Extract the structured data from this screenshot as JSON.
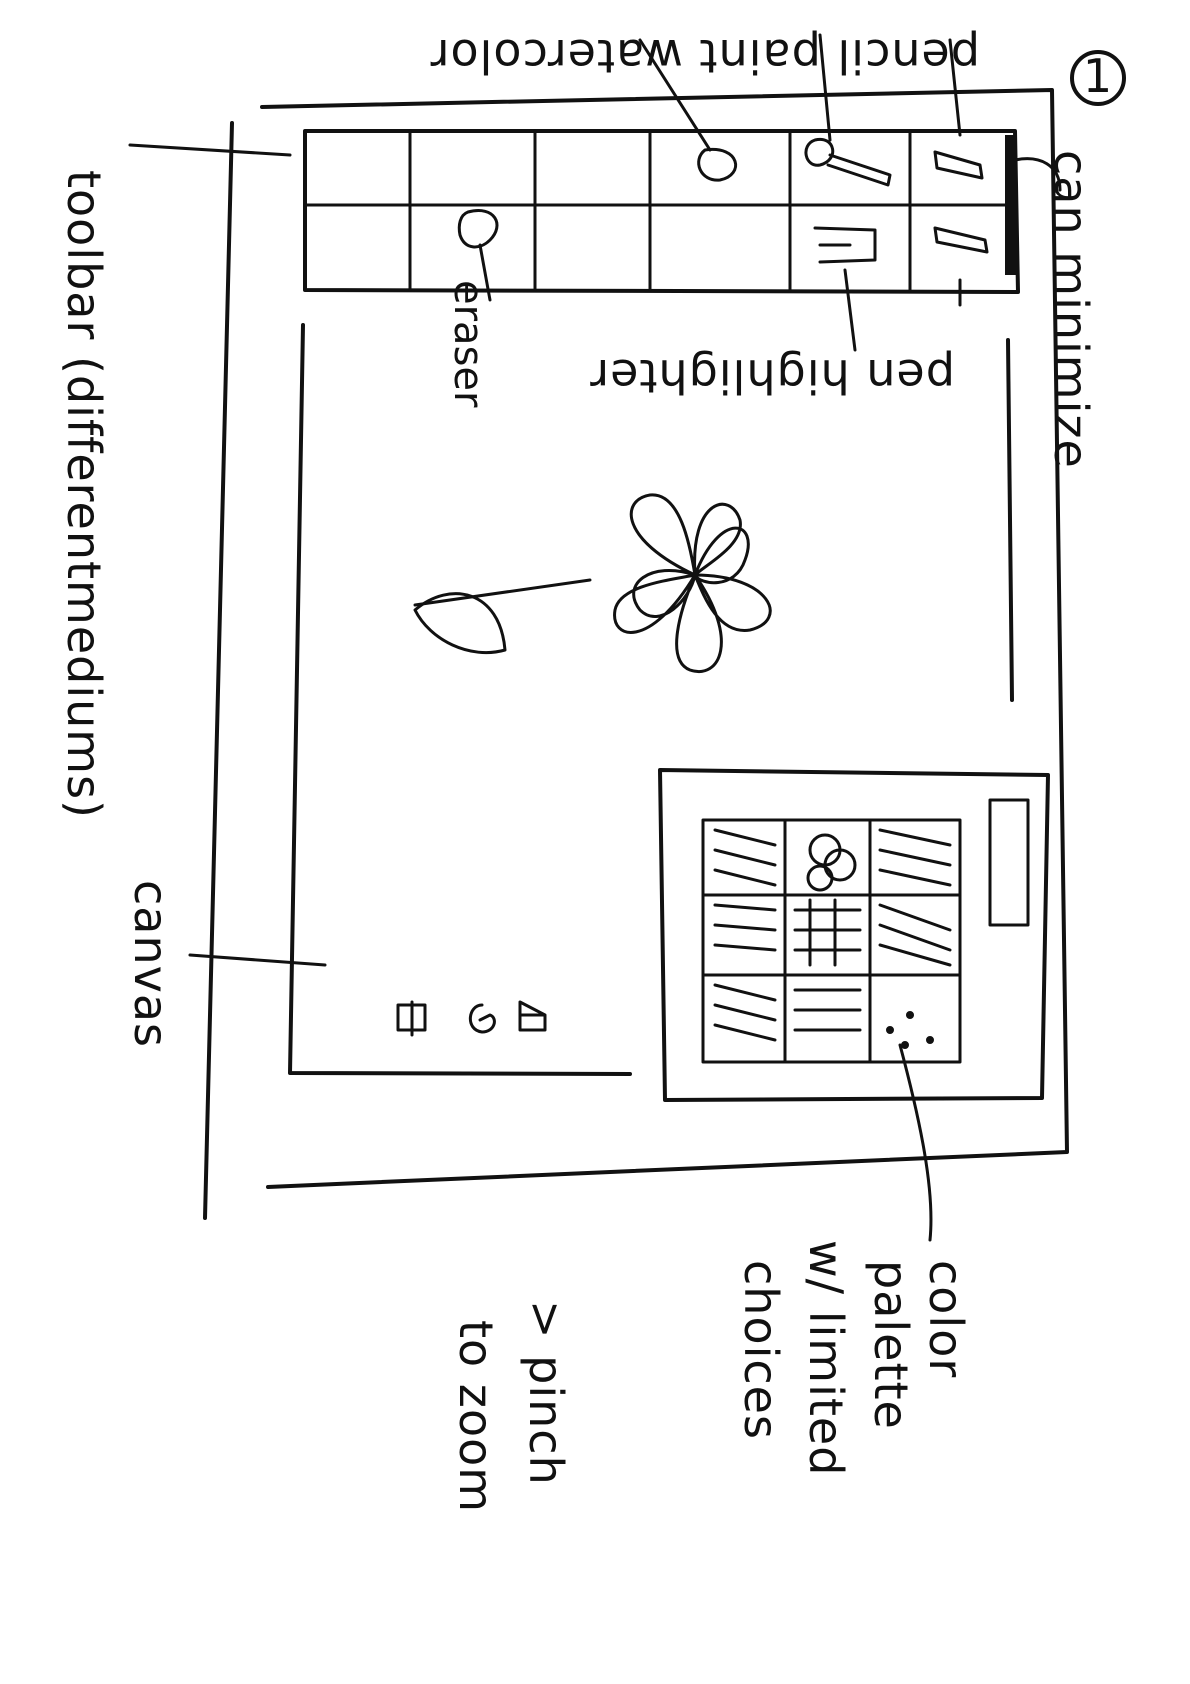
{
  "page_number": "1",
  "labels": {
    "can_minimize": "can minimize",
    "pencil_paint_watercolor": "pencil paint watercolor",
    "pen_highlighter": "pen highlighter",
    "eraser": "eraser",
    "toolbar": "toolbar (differentmediums)",
    "canvas": "canvas",
    "color_palette_line1": "color",
    "color_palette_line2": "palette",
    "color_palette_line3": "w/ limited",
    "color_palette_line4": "choices",
    "pinch_line1": "> pinch",
    "pinch_line2": "to zoom"
  },
  "icons": [
    "home-icon",
    "undo-icon",
    "trash-icon",
    "pencil-icon",
    "pen-icon",
    "paintbrush-icon",
    "highlighter-icon",
    "watercolor-drop-icon",
    "eraser-icon",
    "minimize-handle-icon",
    "flower-drawing"
  ],
  "colors": {
    "ink": "#111111",
    "paper": "#ffffff"
  }
}
